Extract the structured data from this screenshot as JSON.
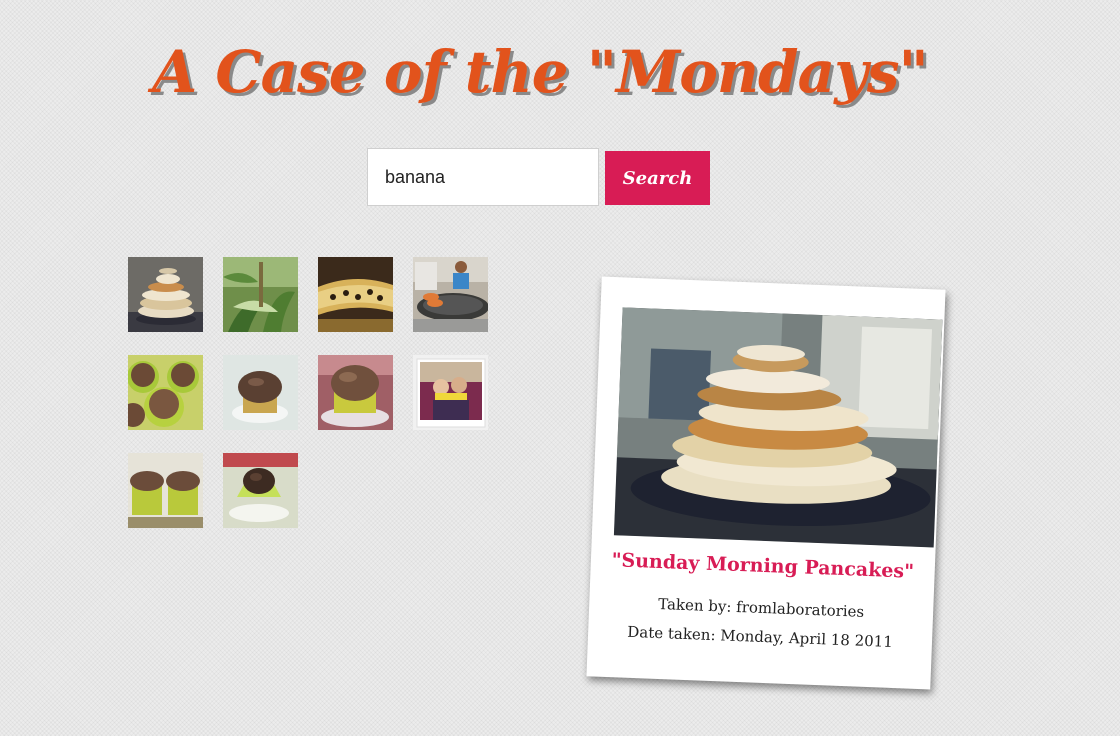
{
  "header": {
    "title": "A Case of the \"Mondays\""
  },
  "search": {
    "value": "banana",
    "button_label": "Search"
  },
  "results": {
    "thumbnails": [
      "pancake-stack-photo",
      "banana-tree-photo",
      "banana-leaf-food-photo",
      "street-vendor-photo",
      "banana-muffins-photo",
      "muffin-on-plate-photo",
      "muffin-on-glass-plate-photo",
      "polaroid-two-people-photo",
      "muffins-in-cups-photo",
      "muffin-halved-photo"
    ]
  },
  "selected_photo": {
    "title": "\"Sunday Morning Pancakes\"",
    "author_line": "Taken by: fromlaboratories",
    "date_line": "Date taken: Monday, April 18 2011"
  },
  "colors": {
    "title": "#e2531c",
    "accent": "#d81c55"
  }
}
